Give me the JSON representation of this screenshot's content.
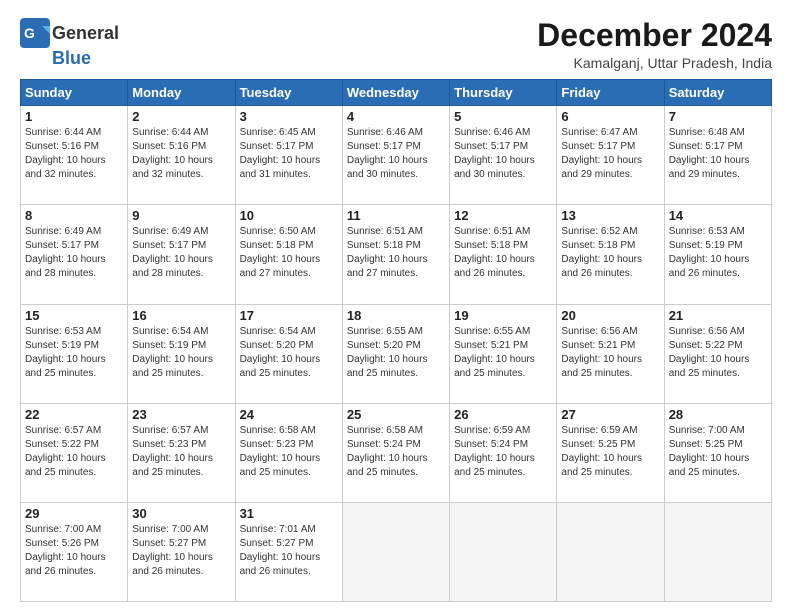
{
  "header": {
    "logo_line1": "General",
    "logo_line2": "Blue",
    "title": "December 2024",
    "subtitle": "Kamalganj, Uttar Pradesh, India"
  },
  "calendar": {
    "days_of_week": [
      "Sunday",
      "Monday",
      "Tuesday",
      "Wednesday",
      "Thursday",
      "Friday",
      "Saturday"
    ],
    "weeks": [
      [
        null,
        {
          "day": "2",
          "sunrise": "Sunrise: 6:44 AM",
          "sunset": "Sunset: 5:16 PM",
          "daylight": "Daylight: 10 hours and 32 minutes."
        },
        {
          "day": "3",
          "sunrise": "Sunrise: 6:45 AM",
          "sunset": "Sunset: 5:17 PM",
          "daylight": "Daylight: 10 hours and 31 minutes."
        },
        {
          "day": "4",
          "sunrise": "Sunrise: 6:46 AM",
          "sunset": "Sunset: 5:17 PM",
          "daylight": "Daylight: 10 hours and 30 minutes."
        },
        {
          "day": "5",
          "sunrise": "Sunrise: 6:46 AM",
          "sunset": "Sunset: 5:17 PM",
          "daylight": "Daylight: 10 hours and 30 minutes."
        },
        {
          "day": "6",
          "sunrise": "Sunrise: 6:47 AM",
          "sunset": "Sunset: 5:17 PM",
          "daylight": "Daylight: 10 hours and 29 minutes."
        },
        {
          "day": "7",
          "sunrise": "Sunrise: 6:48 AM",
          "sunset": "Sunset: 5:17 PM",
          "daylight": "Daylight: 10 hours and 29 minutes."
        }
      ],
      [
        {
          "day": "1",
          "sunrise": "Sunrise: 6:44 AM",
          "sunset": "Sunset: 5:16 PM",
          "daylight": "Daylight: 10 hours and 32 minutes."
        },
        {
          "day": "9",
          "sunrise": "Sunrise: 6:49 AM",
          "sunset": "Sunset: 5:17 PM",
          "daylight": "Daylight: 10 hours and 28 minutes."
        },
        {
          "day": "10",
          "sunrise": "Sunrise: 6:50 AM",
          "sunset": "Sunset: 5:18 PM",
          "daylight": "Daylight: 10 hours and 27 minutes."
        },
        {
          "day": "11",
          "sunrise": "Sunrise: 6:51 AM",
          "sunset": "Sunset: 5:18 PM",
          "daylight": "Daylight: 10 hours and 27 minutes."
        },
        {
          "day": "12",
          "sunrise": "Sunrise: 6:51 AM",
          "sunset": "Sunset: 5:18 PM",
          "daylight": "Daylight: 10 hours and 26 minutes."
        },
        {
          "day": "13",
          "sunrise": "Sunrise: 6:52 AM",
          "sunset": "Sunset: 5:18 PM",
          "daylight": "Daylight: 10 hours and 26 minutes."
        },
        {
          "day": "14",
          "sunrise": "Sunrise: 6:53 AM",
          "sunset": "Sunset: 5:19 PM",
          "daylight": "Daylight: 10 hours and 26 minutes."
        }
      ],
      [
        {
          "day": "8",
          "sunrise": "Sunrise: 6:49 AM",
          "sunset": "Sunset: 5:17 PM",
          "daylight": "Daylight: 10 hours and 28 minutes."
        },
        {
          "day": "16",
          "sunrise": "Sunrise: 6:54 AM",
          "sunset": "Sunset: 5:19 PM",
          "daylight": "Daylight: 10 hours and 25 minutes."
        },
        {
          "day": "17",
          "sunrise": "Sunrise: 6:54 AM",
          "sunset": "Sunset: 5:20 PM",
          "daylight": "Daylight: 10 hours and 25 minutes."
        },
        {
          "day": "18",
          "sunrise": "Sunrise: 6:55 AM",
          "sunset": "Sunset: 5:20 PM",
          "daylight": "Daylight: 10 hours and 25 minutes."
        },
        {
          "day": "19",
          "sunrise": "Sunrise: 6:55 AM",
          "sunset": "Sunset: 5:21 PM",
          "daylight": "Daylight: 10 hours and 25 minutes."
        },
        {
          "day": "20",
          "sunrise": "Sunrise: 6:56 AM",
          "sunset": "Sunset: 5:21 PM",
          "daylight": "Daylight: 10 hours and 25 minutes."
        },
        {
          "day": "21",
          "sunrise": "Sunrise: 6:56 AM",
          "sunset": "Sunset: 5:22 PM",
          "daylight": "Daylight: 10 hours and 25 minutes."
        }
      ],
      [
        {
          "day": "15",
          "sunrise": "Sunrise: 6:53 AM",
          "sunset": "Sunset: 5:19 PM",
          "daylight": "Daylight: 10 hours and 25 minutes."
        },
        {
          "day": "23",
          "sunrise": "Sunrise: 6:57 AM",
          "sunset": "Sunset: 5:23 PM",
          "daylight": "Daylight: 10 hours and 25 minutes."
        },
        {
          "day": "24",
          "sunrise": "Sunrise: 6:58 AM",
          "sunset": "Sunset: 5:23 PM",
          "daylight": "Daylight: 10 hours and 25 minutes."
        },
        {
          "day": "25",
          "sunrise": "Sunrise: 6:58 AM",
          "sunset": "Sunset: 5:24 PM",
          "daylight": "Daylight: 10 hours and 25 minutes."
        },
        {
          "day": "26",
          "sunrise": "Sunrise: 6:59 AM",
          "sunset": "Sunset: 5:24 PM",
          "daylight": "Daylight: 10 hours and 25 minutes."
        },
        {
          "day": "27",
          "sunrise": "Sunrise: 6:59 AM",
          "sunset": "Sunset: 5:25 PM",
          "daylight": "Daylight: 10 hours and 25 minutes."
        },
        {
          "day": "28",
          "sunrise": "Sunrise: 7:00 AM",
          "sunset": "Sunset: 5:25 PM",
          "daylight": "Daylight: 10 hours and 25 minutes."
        }
      ],
      [
        {
          "day": "22",
          "sunrise": "Sunrise: 6:57 AM",
          "sunset": "Sunset: 5:22 PM",
          "daylight": "Daylight: 10 hours and 25 minutes."
        },
        {
          "day": "30",
          "sunrise": "Sunrise: 7:00 AM",
          "sunset": "Sunset: 5:27 PM",
          "daylight": "Daylight: 10 hours and 26 minutes."
        },
        {
          "day": "31",
          "sunrise": "Sunrise: 7:01 AM",
          "sunset": "Sunset: 5:27 PM",
          "daylight": "Daylight: 10 hours and 26 minutes."
        },
        null,
        null,
        null,
        null
      ],
      [
        {
          "day": "29",
          "sunrise": "Sunrise: 7:00 AM",
          "sunset": "Sunset: 5:26 PM",
          "daylight": "Daylight: 10 hours and 26 minutes."
        },
        null,
        null,
        null,
        null,
        null,
        null
      ]
    ]
  }
}
